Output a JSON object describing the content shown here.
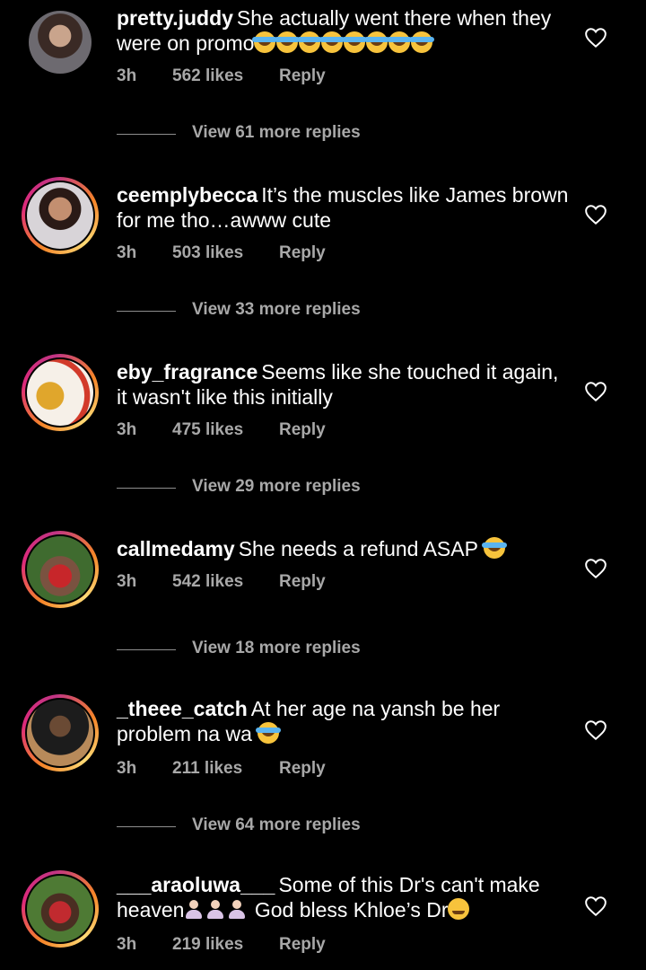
{
  "comments": [
    {
      "username": "pretty.juddy",
      "text": "She actually went there when they were on promo",
      "emojis": "laughing-tears-x8",
      "time": "3h",
      "likes": "562 likes",
      "reply": "Reply",
      "view_replies": "View 61 more replies"
    },
    {
      "username": "ceemplybecca",
      "text": "It’s the muscles like James brown for me tho…awww cute",
      "time": "3h",
      "likes": "503 likes",
      "reply": "Reply",
      "view_replies": "View 33 more replies"
    },
    {
      "username": "eby_fragrance",
      "text": "Seems like she touched it again, it wasn't like this initially",
      "time": "3h",
      "likes": "475 likes",
      "reply": "Reply",
      "view_replies": "View 29 more replies"
    },
    {
      "username": "callmedamy",
      "text": "She needs a refund ASAP",
      "emojis": "laughing-tears",
      "time": "3h",
      "likes": "542 likes",
      "reply": "Reply",
      "view_replies": "View 18 more replies"
    },
    {
      "username": "_theee_catch",
      "text": "At her age na yansh be her problem na wa",
      "emojis": "laughing-tears",
      "time": "3h",
      "likes": "211 likes",
      "reply": "Reply",
      "view_replies": "View 64 more replies"
    },
    {
      "username": "___araoluwa___",
      "text_a": "Some of this Dr's can't make heaven",
      "text_b": "God bless Khloe’s Dr",
      "emojis": "woman-shrugging-x3, wink",
      "time": "3h",
      "likes": "219 likes",
      "reply": "Reply"
    }
  ],
  "colors": {
    "background": "#000000",
    "text": "#ffffff",
    "muted": "#a8a8a8",
    "story_ring": "#dd2a7b"
  },
  "icons": {
    "like": "heart-outline-icon"
  }
}
